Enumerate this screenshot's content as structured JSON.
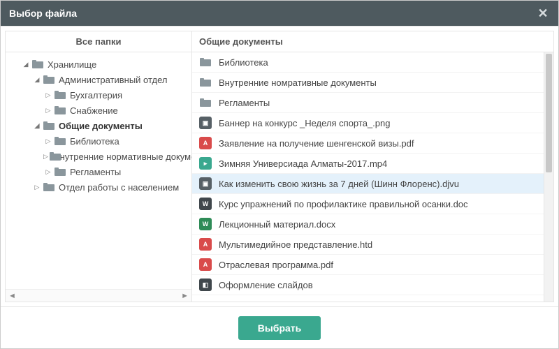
{
  "dialog": {
    "title": "Выбор файла"
  },
  "leftPane": {
    "header": "Все папки"
  },
  "rightPane": {
    "header": "Общие документы"
  },
  "tree": {
    "root": {
      "label": "Хранилище",
      "children": [
        {
          "label": "Административный отдел",
          "expanded": true,
          "children": [
            {
              "label": "Бухгалтерия"
            },
            {
              "label": "Снабжение"
            }
          ]
        },
        {
          "label": "Общие документы",
          "expanded": true,
          "selected": true,
          "children": [
            {
              "label": "Библиотека"
            },
            {
              "label": "Внутренние нормативные документы"
            },
            {
              "label": "Регламенты"
            }
          ]
        },
        {
          "label": "Отдел работы с населением",
          "expanded": false
        }
      ]
    }
  },
  "files": [
    {
      "name": "Библиотека",
      "type": "folder"
    },
    {
      "name": "Внутренние номративные документы",
      "type": "folder"
    },
    {
      "name": "Регламенты",
      "type": "folder"
    },
    {
      "name": "Баннер на конкурс _Неделя спорта_.png",
      "type": "img"
    },
    {
      "name": "Заявление на получение шенгенской визы.pdf",
      "type": "pdf"
    },
    {
      "name": "Зимняя Универсиада Алматы-2017.mp4",
      "type": "vid"
    },
    {
      "name": "Как изменить свою жизнь за 7 дней (Шинн Флоренс).djvu",
      "type": "djvu",
      "selected": true
    },
    {
      "name": "Курс упражнений по профилактике правильной осанки.doc",
      "type": "doc"
    },
    {
      "name": "Лекционный материал.docx",
      "type": "docx"
    },
    {
      "name": "Мультимедийное представление.htd",
      "type": "htd"
    },
    {
      "name": "Отраслевая программа.pdf",
      "type": "pdf"
    },
    {
      "name": "Оформление слайдов",
      "type": "presentation"
    }
  ],
  "footer": {
    "selectLabel": "Выбрать"
  },
  "iconGlyphs": {
    "img": "▣",
    "pdf": "A",
    "vid": "▸",
    "djvu": "▣",
    "doc": "W",
    "docx": "W",
    "htd": "A",
    "presentation": "◧"
  }
}
